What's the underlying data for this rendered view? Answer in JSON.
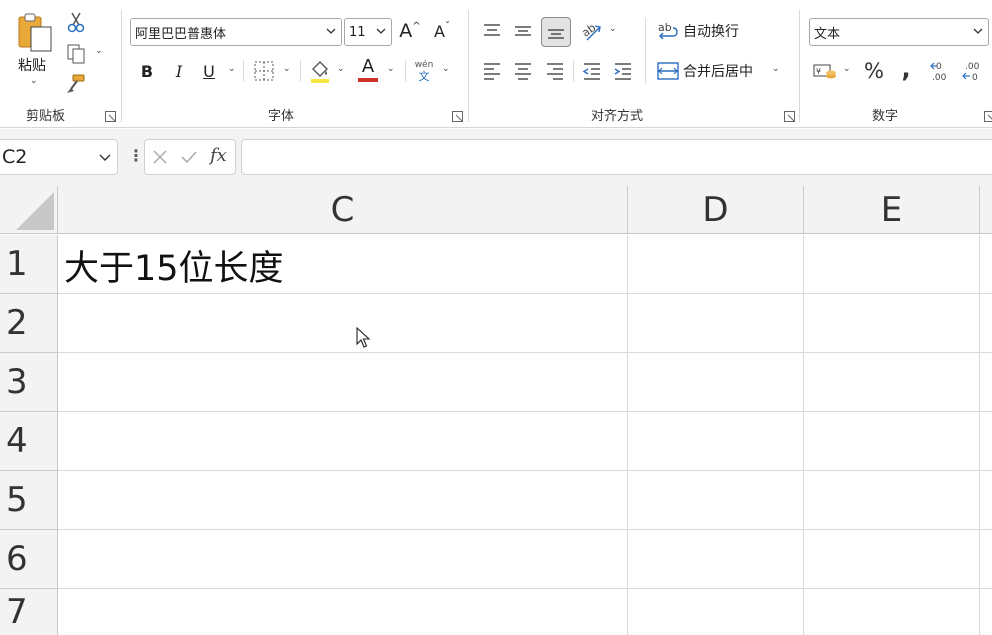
{
  "ribbon": {
    "clipboard": {
      "paste_label": "粘贴",
      "group_label": "剪贴板"
    },
    "font": {
      "font_name": "阿里巴巴普惠体",
      "font_size": "11",
      "grow_label": "A",
      "shrink_label": "A",
      "bold_label": "B",
      "italic_label": "I",
      "underline_label": "U",
      "font_color_label": "A",
      "phonetic_top": "wén",
      "phonetic_bottom": "文",
      "group_label": "字体",
      "highlight_color": "#f5e642",
      "font_color": "#d0322b"
    },
    "alignment": {
      "wrap_text_label": "自动换行",
      "merge_center_label": "合并后居中",
      "group_label": "对齐方式"
    },
    "number": {
      "format_value": "文本",
      "percent_label": "%",
      "comma_label": ",",
      "group_label": "数字"
    }
  },
  "formula_bar": {
    "name_box": "C2",
    "fx_label": "fx",
    "formula_value": ""
  },
  "grid": {
    "columns": [
      "C",
      "D",
      "E"
    ],
    "rows": [
      "1",
      "2",
      "3",
      "4",
      "5",
      "6",
      "7"
    ],
    "cells": {
      "C1": "大于15位长度"
    }
  }
}
